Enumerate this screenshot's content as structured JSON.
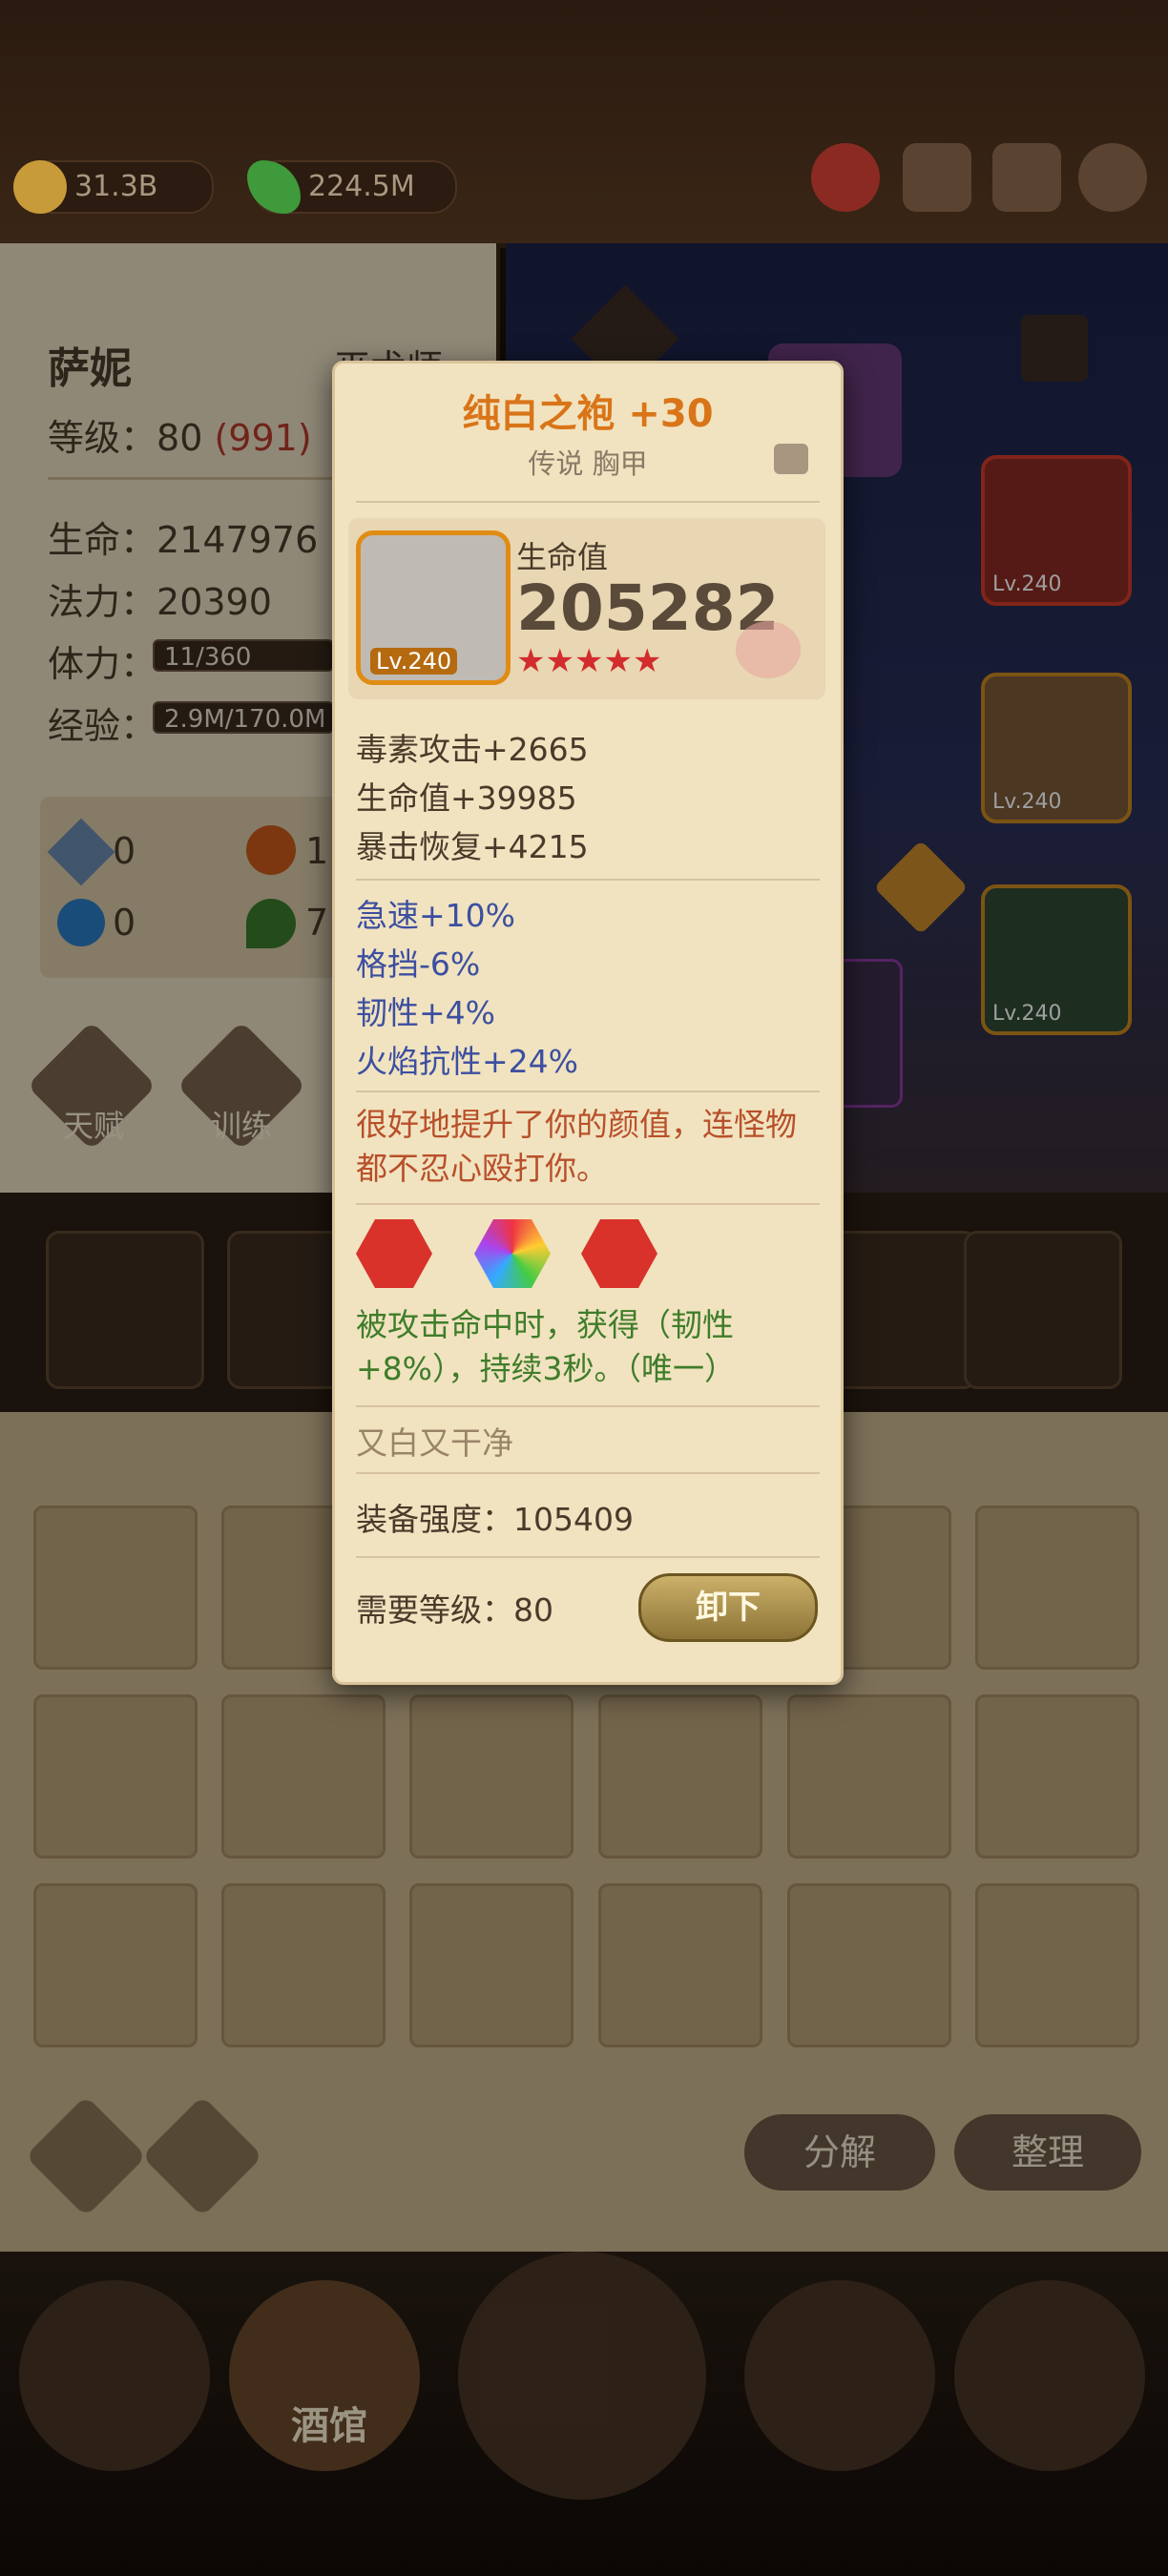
{
  "resources": [
    {
      "icon": "gold-coin-icon",
      "value": "31.3B"
    },
    {
      "icon": "green-gem-icon",
      "value": "224.5M"
    }
  ],
  "topbar_icons": [
    "alert-icon",
    "chat-icon",
    "mail-icon",
    "settings-gear-icon"
  ],
  "hero": {
    "name": "萨妮",
    "class": "巫术师",
    "level_label": "等级：",
    "level": "80",
    "level_extra": "(991)",
    "hp_label": "生命：",
    "hp": "2147976",
    "mana_label": "法力：",
    "mana": "20390",
    "stamina_label": "体力：",
    "stamina": "11/360",
    "exp_label": "经验：",
    "exp": "2.9M/170.0M",
    "mini_stats": [
      {
        "icon": "sword-icon",
        "value": "0"
      },
      {
        "icon": "fire-icon",
        "value": "1"
      },
      {
        "icon": "snowflake-icon",
        "value": "0"
      },
      {
        "icon": "leaf-icon",
        "value": "7"
      }
    ],
    "buttons": {
      "talent": "天赋",
      "train": "训练"
    }
  },
  "equipped_slots": [
    {
      "level": "Lv.240"
    },
    {
      "level": "Lv.240"
    },
    {
      "level": "Lv.240"
    }
  ],
  "popup": {
    "title": "纯白之袍 +30",
    "subtitle": "传说 胸甲",
    "item_level": "Lv.240",
    "main_stat_label": "生命值",
    "main_stat_value": "205282",
    "stars": 5,
    "base_attrs": [
      "毒素攻击+2665",
      "生命值+39985",
      "暴击恢复+4215"
    ],
    "bonus_attrs": [
      "急速+10%",
      "格挡-6%",
      "韧性+4%",
      "火焰抗性+24%"
    ],
    "flavor": "很好地提升了你的颜值，连怪物都不忍心殴打你。",
    "gems": [
      "red-gem-icon",
      "rainbow-gem-icon",
      "red-gem-icon"
    ],
    "set_effect": "被攻击命中时，获得（韧性+8%），持续3秒。（唯一）",
    "quote": "又白又干净",
    "power_label": "装备强度：",
    "power": "105409",
    "req_label": "需要等级：",
    "req": "80",
    "unequip_label": "卸下"
  },
  "inventory": {
    "decompose": "分解",
    "organize": "整理"
  },
  "nav": {
    "tavern": "酒馆"
  },
  "colors": {
    "accent": "#d88a1a",
    "title": "#d97518",
    "blue_attr": "#3c4fa0",
    "green_effect": "#3f7d2a",
    "flavor": "#b8502a"
  }
}
